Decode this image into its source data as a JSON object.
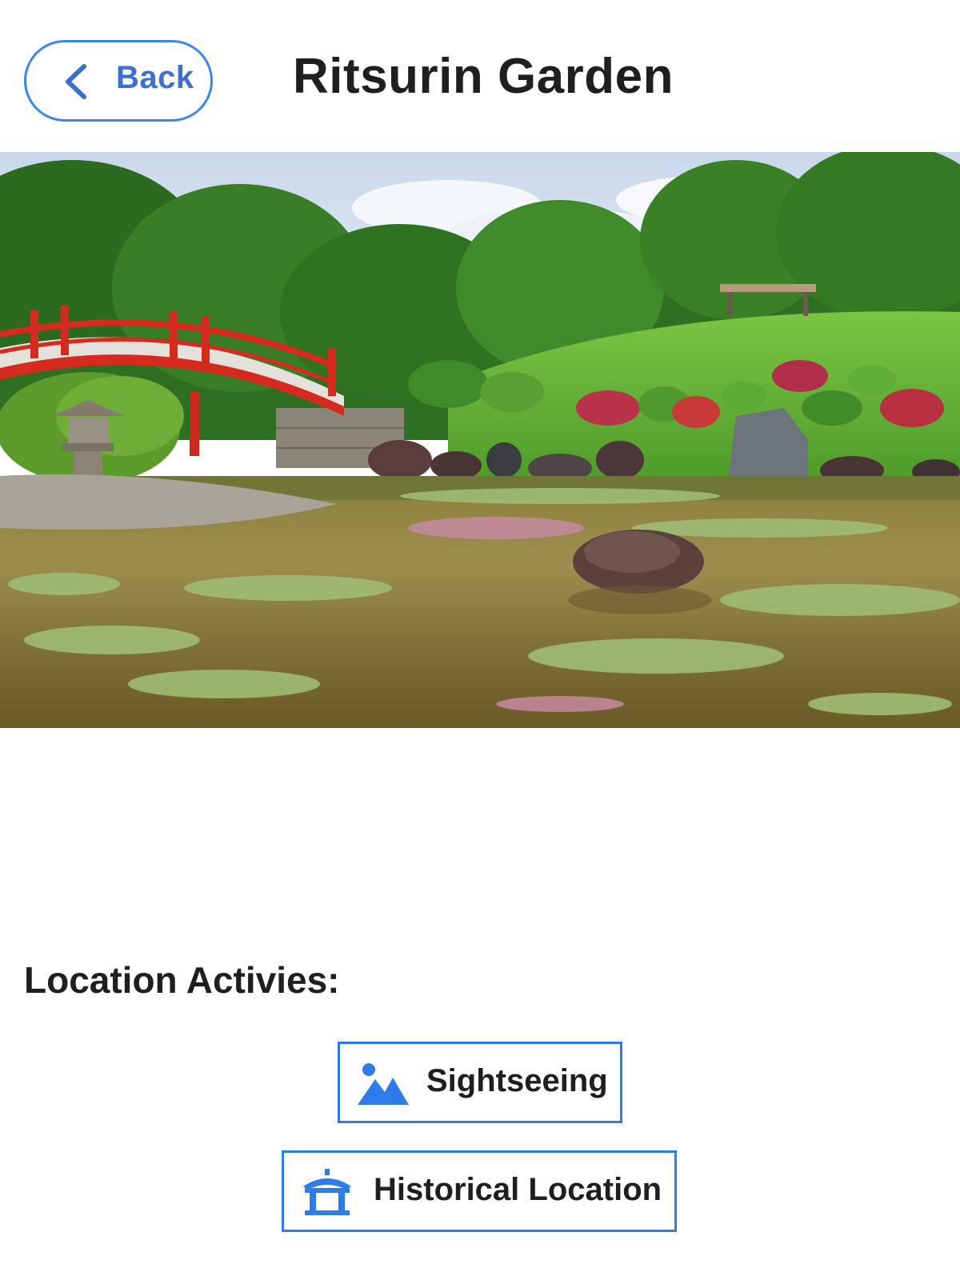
{
  "header": {
    "back_label": "Back",
    "title": "Ritsurin Garden"
  },
  "hero": {
    "icon": "garden-photo"
  },
  "activities": {
    "title": "Location Activies:",
    "items": [
      {
        "label": "Sightseeing",
        "icon": "landscape-icon"
      },
      {
        "label": "Historical Location",
        "icon": "pagoda-icon"
      }
    ]
  },
  "colors": {
    "accent": "#3b86e6",
    "text": "#1f1f1f",
    "background": "#ffffff"
  }
}
